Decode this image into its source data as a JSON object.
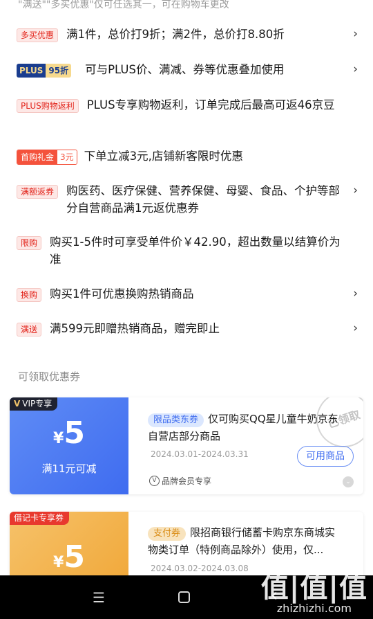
{
  "top_note": "\"满送\"\"多买优惠\"仅可任选其一，可在购物车更改",
  "promos": [
    {
      "tag": "多买优惠",
      "text": "满1件，总价打9折；满2件，总价打8.80折",
      "chevron": "›"
    },
    {
      "tag_a": "PLUS",
      "tag_b": "95折",
      "text": "可与PLUS价、满减、券等优惠叠加使用",
      "chevron": "›"
    },
    {
      "tag": "PLUS购物返利",
      "text": "PLUS专享购物返利，订单完成后最高可返46京豆"
    },
    {
      "tag_a": "首购礼金",
      "tag_b": "3元",
      "text": "下单立减3元,店铺新客限时优惠"
    },
    {
      "tag": "满额返券",
      "text": "购医药、医疗保健、营养保健、母婴、食品、个护等部分自营商品满1元返优惠券",
      "chevron": "›"
    },
    {
      "tag": "限购",
      "text": "购买1-5件时可享受单件价￥42.90，超出数量以结算价为准"
    },
    {
      "tag": "换购",
      "text": "购买1件可优惠换购热销商品",
      "chevron": "›"
    },
    {
      "tag": "满送",
      "text": "满599元即赠热销商品，赠完即止",
      "chevron": "›"
    }
  ],
  "coupons_title": "可领取优惠券",
  "coupons": [
    {
      "badge": "VIP专享",
      "badge_mark": "V",
      "currency": "¥",
      "amount": "5",
      "condition": "满11元可减",
      "type_label": "限品类东券",
      "desc": "仅可购买QQ星儿童牛奶京东自营店部分商品",
      "date": "2024.03.01-2024.03.31",
      "button": "可用商品",
      "footer_icon": "V",
      "footer": "品牌会员专享",
      "stamp": "已领取"
    },
    {
      "badge": "借记卡专享券",
      "currency": "¥",
      "amount": "5",
      "type_label": "支付券",
      "desc": "限招商银行储蓄卡购京东商城实物类订单（特例商品除外）使用，仅...",
      "date": "2024.03.02-2024.03.08"
    }
  ],
  "nav": {
    "menu_icon": "☰",
    "back_icon": "‹"
  },
  "watermark": {
    "logo": "值|值|值",
    "url": "zhizhizhi.com"
  },
  "colors": {
    "accent_red": "#e2231a",
    "coupon_blue": "#3f6cf0",
    "coupon_gold": "#f0a534",
    "plus_navy": "#1a3d8f"
  }
}
